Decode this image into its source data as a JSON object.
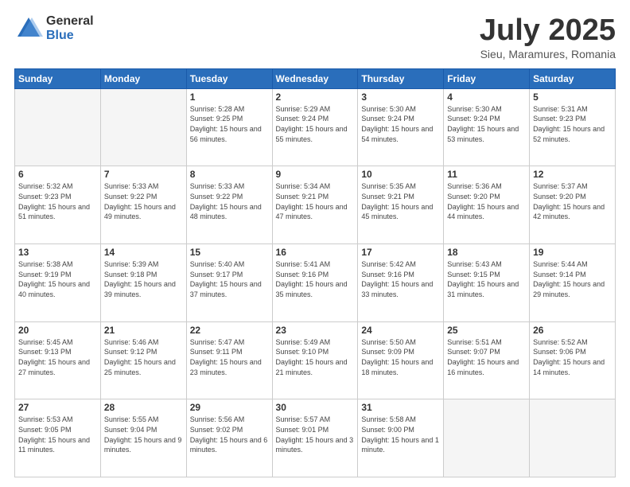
{
  "header": {
    "logo_general": "General",
    "logo_blue": "Blue",
    "month_title": "July 2025",
    "subtitle": "Sieu, Maramures, Romania"
  },
  "calendar": {
    "headers": [
      "Sunday",
      "Monday",
      "Tuesday",
      "Wednesday",
      "Thursday",
      "Friday",
      "Saturday"
    ],
    "weeks": [
      [
        {
          "day": "",
          "empty": true
        },
        {
          "day": "",
          "empty": true
        },
        {
          "day": "1",
          "sunrise": "5:28 AM",
          "sunset": "9:25 PM",
          "daylight": "15 hours and 56 minutes."
        },
        {
          "day": "2",
          "sunrise": "5:29 AM",
          "sunset": "9:24 PM",
          "daylight": "15 hours and 55 minutes."
        },
        {
          "day": "3",
          "sunrise": "5:30 AM",
          "sunset": "9:24 PM",
          "daylight": "15 hours and 54 minutes."
        },
        {
          "day": "4",
          "sunrise": "5:30 AM",
          "sunset": "9:24 PM",
          "daylight": "15 hours and 53 minutes."
        },
        {
          "day": "5",
          "sunrise": "5:31 AM",
          "sunset": "9:23 PM",
          "daylight": "15 hours and 52 minutes."
        }
      ],
      [
        {
          "day": "6",
          "sunrise": "5:32 AM",
          "sunset": "9:23 PM",
          "daylight": "15 hours and 51 minutes."
        },
        {
          "day": "7",
          "sunrise": "5:33 AM",
          "sunset": "9:22 PM",
          "daylight": "15 hours and 49 minutes."
        },
        {
          "day": "8",
          "sunrise": "5:33 AM",
          "sunset": "9:22 PM",
          "daylight": "15 hours and 48 minutes."
        },
        {
          "day": "9",
          "sunrise": "5:34 AM",
          "sunset": "9:21 PM",
          "daylight": "15 hours and 47 minutes."
        },
        {
          "day": "10",
          "sunrise": "5:35 AM",
          "sunset": "9:21 PM",
          "daylight": "15 hours and 45 minutes."
        },
        {
          "day": "11",
          "sunrise": "5:36 AM",
          "sunset": "9:20 PM",
          "daylight": "15 hours and 44 minutes."
        },
        {
          "day": "12",
          "sunrise": "5:37 AM",
          "sunset": "9:20 PM",
          "daylight": "15 hours and 42 minutes."
        }
      ],
      [
        {
          "day": "13",
          "sunrise": "5:38 AM",
          "sunset": "9:19 PM",
          "daylight": "15 hours and 40 minutes."
        },
        {
          "day": "14",
          "sunrise": "5:39 AM",
          "sunset": "9:18 PM",
          "daylight": "15 hours and 39 minutes."
        },
        {
          "day": "15",
          "sunrise": "5:40 AM",
          "sunset": "9:17 PM",
          "daylight": "15 hours and 37 minutes."
        },
        {
          "day": "16",
          "sunrise": "5:41 AM",
          "sunset": "9:16 PM",
          "daylight": "15 hours and 35 minutes."
        },
        {
          "day": "17",
          "sunrise": "5:42 AM",
          "sunset": "9:16 PM",
          "daylight": "15 hours and 33 minutes."
        },
        {
          "day": "18",
          "sunrise": "5:43 AM",
          "sunset": "9:15 PM",
          "daylight": "15 hours and 31 minutes."
        },
        {
          "day": "19",
          "sunrise": "5:44 AM",
          "sunset": "9:14 PM",
          "daylight": "15 hours and 29 minutes."
        }
      ],
      [
        {
          "day": "20",
          "sunrise": "5:45 AM",
          "sunset": "9:13 PM",
          "daylight": "15 hours and 27 minutes."
        },
        {
          "day": "21",
          "sunrise": "5:46 AM",
          "sunset": "9:12 PM",
          "daylight": "15 hours and 25 minutes."
        },
        {
          "day": "22",
          "sunrise": "5:47 AM",
          "sunset": "9:11 PM",
          "daylight": "15 hours and 23 minutes."
        },
        {
          "day": "23",
          "sunrise": "5:49 AM",
          "sunset": "9:10 PM",
          "daylight": "15 hours and 21 minutes."
        },
        {
          "day": "24",
          "sunrise": "5:50 AM",
          "sunset": "9:09 PM",
          "daylight": "15 hours and 18 minutes."
        },
        {
          "day": "25",
          "sunrise": "5:51 AM",
          "sunset": "9:07 PM",
          "daylight": "15 hours and 16 minutes."
        },
        {
          "day": "26",
          "sunrise": "5:52 AM",
          "sunset": "9:06 PM",
          "daylight": "15 hours and 14 minutes."
        }
      ],
      [
        {
          "day": "27",
          "sunrise": "5:53 AM",
          "sunset": "9:05 PM",
          "daylight": "15 hours and 11 minutes."
        },
        {
          "day": "28",
          "sunrise": "5:55 AM",
          "sunset": "9:04 PM",
          "daylight": "15 hours and 9 minutes."
        },
        {
          "day": "29",
          "sunrise": "5:56 AM",
          "sunset": "9:02 PM",
          "daylight": "15 hours and 6 minutes."
        },
        {
          "day": "30",
          "sunrise": "5:57 AM",
          "sunset": "9:01 PM",
          "daylight": "15 hours and 3 minutes."
        },
        {
          "day": "31",
          "sunrise": "5:58 AM",
          "sunset": "9:00 PM",
          "daylight": "15 hours and 1 minute."
        },
        {
          "day": "",
          "empty": true
        },
        {
          "day": "",
          "empty": true
        }
      ]
    ]
  }
}
